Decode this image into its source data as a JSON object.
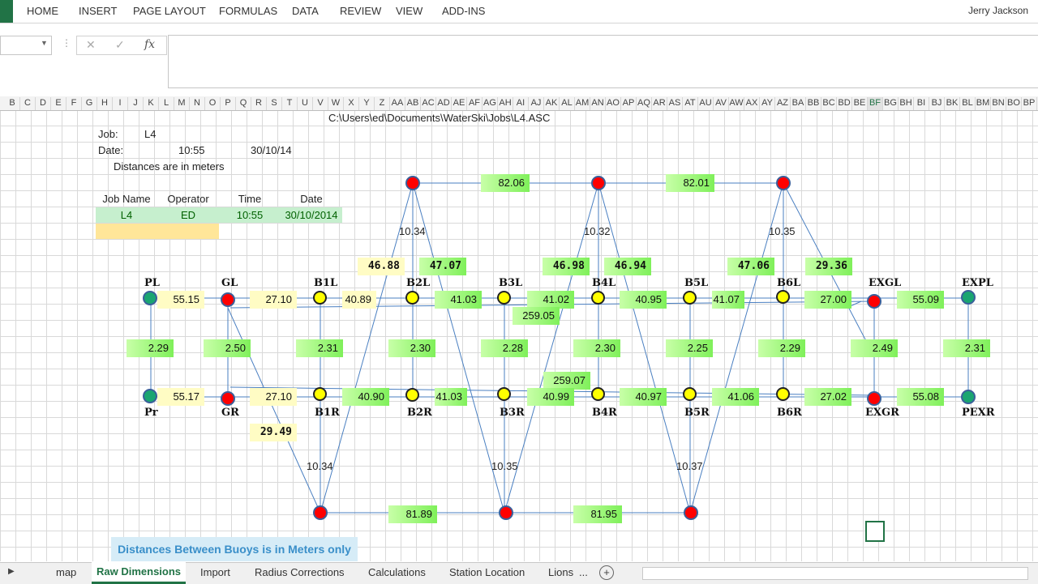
{
  "ribbon": {
    "tabs": [
      "HOME",
      "INSERT",
      "PAGE LAYOUT",
      "FORMULAS",
      "DATA",
      "REVIEW",
      "VIEW",
      "ADD-INS"
    ],
    "user": "Jerry Jackson"
  },
  "formula_bar": {
    "cancel": "✕",
    "enter": "✓",
    "fx": "fx",
    "value": ""
  },
  "columns": [
    "B",
    "C",
    "D",
    "E",
    "F",
    "G",
    "H",
    "I",
    "J",
    "K",
    "L",
    "M",
    "N",
    "O",
    "P",
    "Q",
    "R",
    "S",
    "T",
    "U",
    "V",
    "W",
    "X",
    "Y",
    "Z",
    "AA",
    "AB",
    "AC",
    "AD",
    "AE",
    "AF",
    "AG",
    "AH",
    "AI",
    "AJ",
    "AK",
    "AL",
    "AM",
    "AN",
    "AO",
    "AP",
    "AQ",
    "AR",
    "AS",
    "AT",
    "AU",
    "AV",
    "AW",
    "AX",
    "AY",
    "AZ",
    "BA",
    "BB",
    "BC",
    "BD",
    "BE",
    "BF",
    "BG",
    "BH",
    "BI",
    "BJ",
    "BK",
    "BL",
    "BM",
    "BN",
    "BO",
    "BP"
  ],
  "selected_column": "BF",
  "sheet": {
    "path": "C:\\Users\\ed\\Documents\\WaterSki\\Jobs\\L4.ASC",
    "job_label": "Job:",
    "job_value": "L4",
    "date_label": "Date:",
    "time_value": "10:55",
    "date_value": "30/10/14",
    "note": "Distances are in meters",
    "table_headers": [
      "Job Name",
      "Operator",
      "Time",
      "Date"
    ],
    "table_row": [
      "L4",
      "ED",
      "10:55",
      "30/10/2014"
    ]
  },
  "diagram": {
    "top_distances": [
      "82.06",
      "82.01"
    ],
    "bottom_distances": [
      "81.89",
      "81.95"
    ],
    "top_verticals": [
      "10.34",
      "10.32",
      "10.35"
    ],
    "bottom_verticals": [
      "10.34",
      "10.35",
      "10.37"
    ],
    "diagonals_top": [
      "46.88",
      "47.07",
      "46.98",
      "46.94",
      "47.06",
      "29.36"
    ],
    "diagonal_bottom": "29.49",
    "left_row_labels": [
      "PL",
      "GL",
      "B1L",
      "B2L",
      "B3L",
      "B4L",
      "B5L",
      "B6L",
      "EXGL",
      "EXPL"
    ],
    "right_row_labels": [
      "Pr",
      "GR",
      "B1R",
      "B2R",
      "B3R",
      "B4R",
      "B5R",
      "B6R",
      "EXGR",
      "PEXR"
    ],
    "left_row_distances": [
      "55.15",
      "27.10",
      "40.89",
      "41.03",
      "41.02",
      "40.95",
      "41.07",
      "27.00",
      "55.09"
    ],
    "right_row_distances": [
      "55.17",
      "27.10",
      "40.90",
      "41.03",
      "40.99",
      "40.97",
      "41.06",
      "27.02",
      "55.08"
    ],
    "widths": [
      "2.29",
      "2.50",
      "2.31",
      "2.30",
      "2.28",
      "2.30",
      "2.25",
      "2.29",
      "2.49",
      "2.31"
    ],
    "long_left": "259.05",
    "long_right": "259.07"
  },
  "banner": "Distances Between Buoys is in Meters only",
  "sheet_tabs": [
    "map",
    "Raw Dimensions",
    "Import",
    "Radius Corrections",
    "Calculations",
    "Station Location",
    "Lions",
    "..."
  ],
  "active_tab": "Raw Dimensions"
}
